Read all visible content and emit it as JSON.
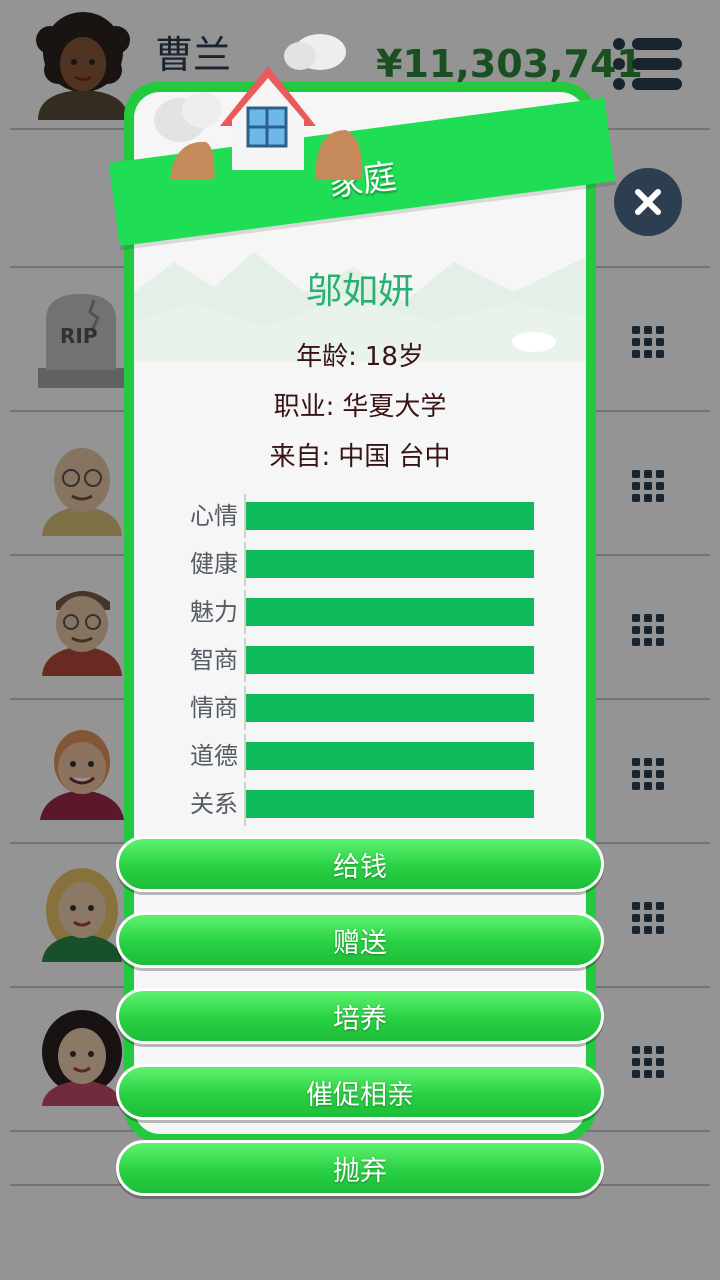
{
  "header": {
    "player_name": "曹兰",
    "money": "¥11,303,741",
    "menu_icon": "menu-icon"
  },
  "background_rows": {
    "tombstone_text": "RIP",
    "row_icon": "grid-icon"
  },
  "modal": {
    "title": "家庭",
    "member_name": "邬如妍",
    "age_label": "年龄:",
    "age_value": "18岁",
    "job_label": "职业:",
    "job_value": "华夏大学",
    "from_label": "来自:",
    "from_value": "中国 台中",
    "stats": [
      {
        "label": "心情",
        "value": 1.0
      },
      {
        "label": "健康",
        "value": 1.0
      },
      {
        "label": "魅力",
        "value": 1.0
      },
      {
        "label": "智商",
        "value": 1.0
      },
      {
        "label": "情商",
        "value": 1.0
      },
      {
        "label": "道德",
        "value": 1.0
      },
      {
        "label": "关系",
        "value": 1.0
      }
    ],
    "actions": [
      "给钱",
      "赠送",
      "培养",
      "催促相亲",
      "抛弃"
    ]
  },
  "colors": {
    "accent_green": "#23c93f",
    "bar_green": "#0dba5c",
    "money_green": "#2e8b3a",
    "name_green": "#27b070"
  }
}
